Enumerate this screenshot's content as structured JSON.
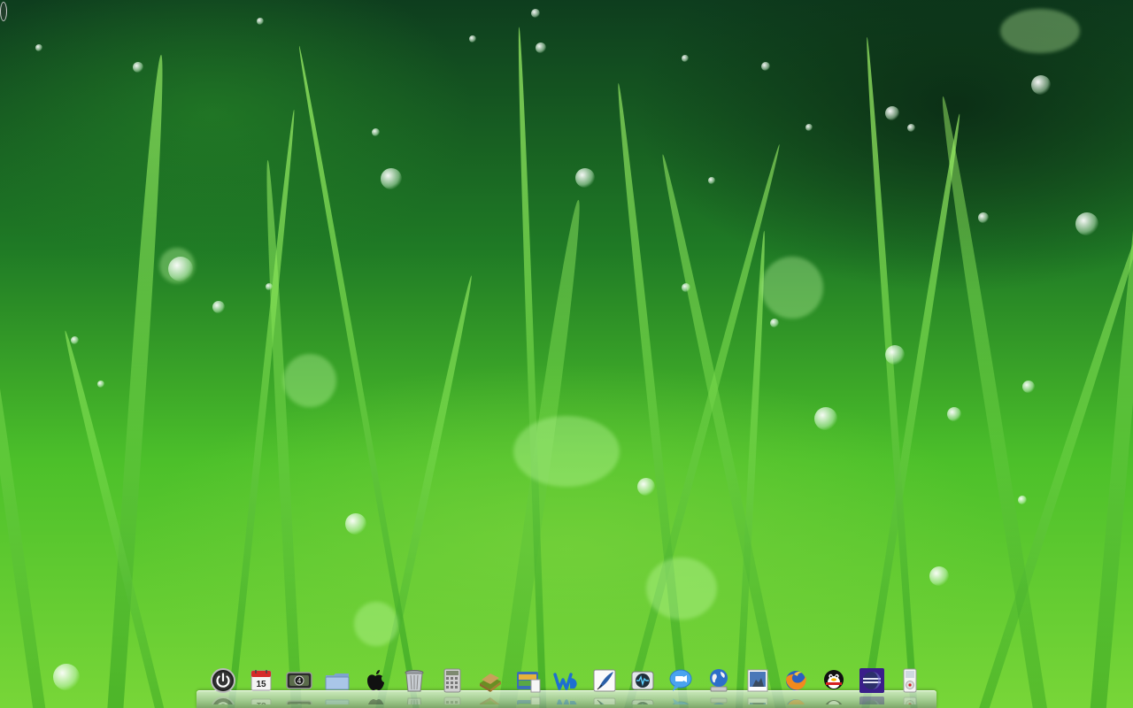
{
  "desktop": {
    "wallpaper": "green-grass-dew",
    "accent": "#4cc02a"
  },
  "calendar": {
    "day": "15"
  },
  "dashboard": {
    "count": "4"
  },
  "dock": {
    "items": [
      {
        "name": "power-icon"
      },
      {
        "name": "calendar-icon"
      },
      {
        "name": "dashboard-icon"
      },
      {
        "name": "folder-icon"
      },
      {
        "name": "apple-icon"
      },
      {
        "name": "trash-icon"
      },
      {
        "name": "calculator-icon"
      },
      {
        "name": "book-icon"
      },
      {
        "name": "file-manager-icon"
      },
      {
        "name": "word-processor-icon"
      },
      {
        "name": "quill-editor-icon"
      },
      {
        "name": "network-monitor-icon"
      },
      {
        "name": "chat-bubble-icon"
      },
      {
        "name": "globe-icon"
      },
      {
        "name": "photo-icon"
      },
      {
        "name": "firefox-icon"
      },
      {
        "name": "penguin-messenger-icon"
      },
      {
        "name": "eclipse-icon"
      },
      {
        "name": "ipod-icon"
      }
    ]
  }
}
